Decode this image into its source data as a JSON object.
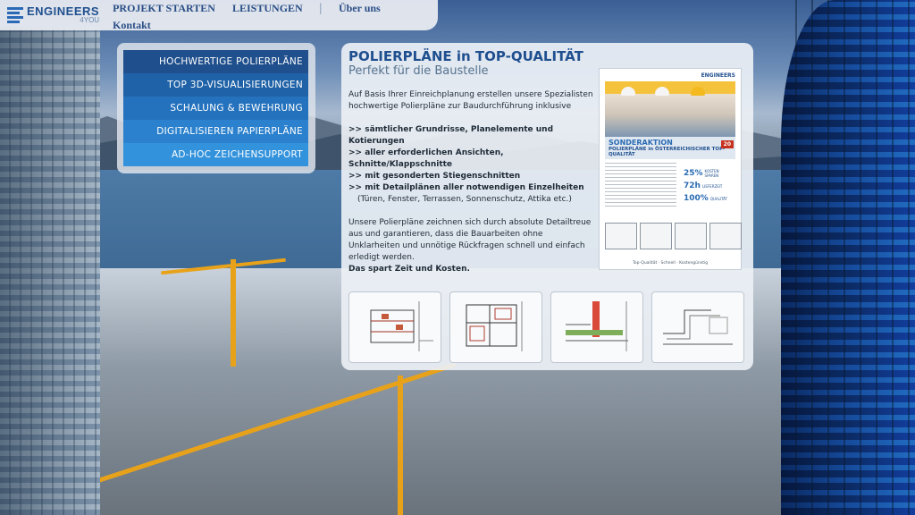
{
  "logo": {
    "name": "ENGINEERS",
    "sub": "4YOU"
  },
  "nav": {
    "items": [
      "PROJEKT STARTEN",
      "LEISTUNGEN",
      "Über uns",
      "Kontakt"
    ],
    "separator": "|"
  },
  "services": [
    "HOCHWERTIGE POLIERPLÄNE",
    "TOP 3D-VISUALISIERUNGEN",
    "SCHALUNG & BEWEHRUNG",
    "DIGITALISIEREN PAPIERPLÄNE",
    "AD-HOC ZEICHENSUPPORT"
  ],
  "main": {
    "title": "POLIERPLÄNE in TOP-QUALITÄT",
    "subtitle": "Perfekt für die Baustelle",
    "intro": "Auf Basis Ihrer Einreichplanung erstellen unsere Spezialisten hochwertige Polierpläne zur Baudurchführung inklusive",
    "list": [
      ">> sämtlicher Grundrisse, Planelemente und Kotierungen",
      ">> aller erforderlichen Ansichten, Schnitte/Klappschnitte",
      ">> mit gesonderten Stiegenschnitten",
      ">> mit Detailplänen aller notwendigen Einzelheiten"
    ],
    "list_note": "(Türen, Fenster, Terrassen, Sonnenschutz, Attika etc.)",
    "outro": "Unsere Polierpläne zeichnen sich durch absolute Detailtreue aus und garantieren, dass die Bauarbeiten ohne Unklarheiten und unnötige Rückfragen schnell und einfach erledigt werden.",
    "closing": "Das spart Zeit und Kosten."
  },
  "flyer": {
    "logo": "ENGINEERS",
    "kicker": "SONDERAKTION",
    "headline": "POLIERPLÄNE in ÖSTERREICHISCHER TOP-QUALITÄT",
    "badge": "20",
    "stats": [
      {
        "num": "25%",
        "label": "KOSTEN SPAREN"
      },
      {
        "num": "72h",
        "label": "LIEFERZEIT"
      },
      {
        "num": "100%",
        "label": "QUALITÄT"
      }
    ],
    "footer": "Top-Qualität · Schnell · Kostengünstig"
  },
  "thumbnails": [
    "Schnitt",
    "Grundriss",
    "Detail",
    "Detail Attika"
  ],
  "colors": {
    "brand_blue": "#1f4f8f",
    "menu_blues": [
      "#1f4f8c",
      "#2062a7",
      "#2472bd",
      "#2b81cd",
      "#3392dc"
    ],
    "crane": "#e8a21a"
  }
}
